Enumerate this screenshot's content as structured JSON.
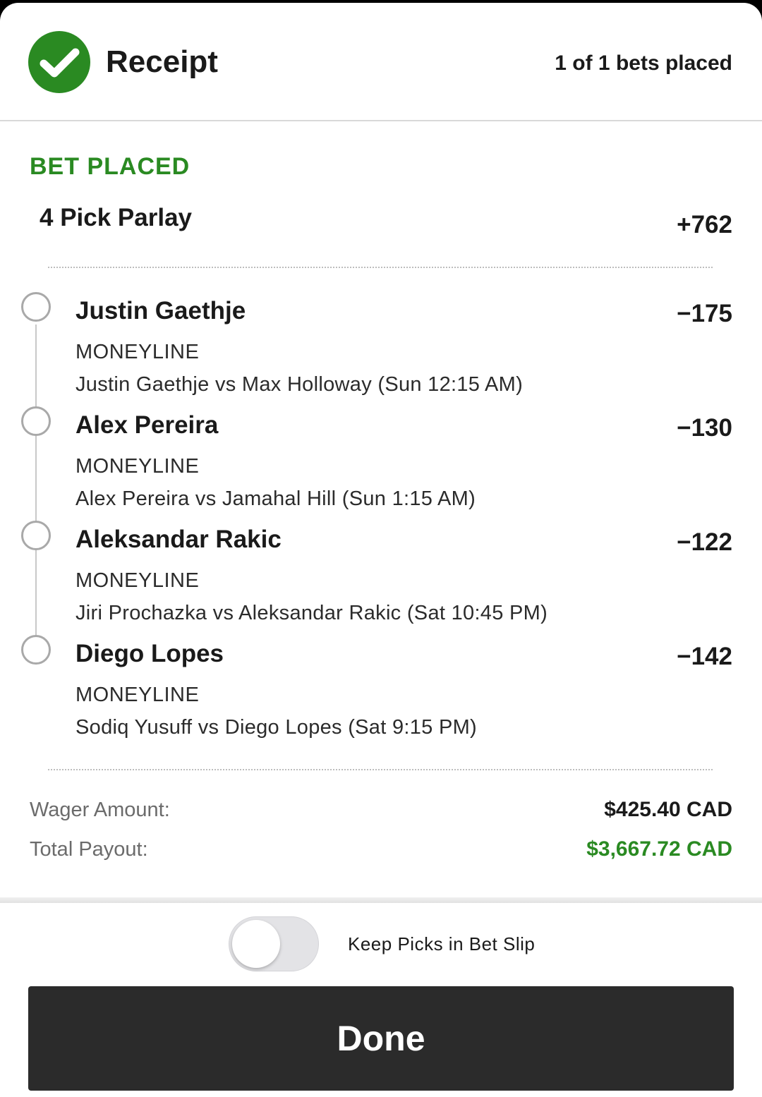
{
  "header": {
    "title": "Receipt",
    "count_text": "1 of 1 bets placed",
    "check_icon": "check-circle-icon",
    "accent_color": "#2a8a22"
  },
  "bet": {
    "status": "BET PLACED",
    "type": "4 Pick Parlay",
    "odds": "+762"
  },
  "legs": [
    {
      "name": "Justin Gaethje",
      "odds": "−175",
      "market": "MONEYLINE",
      "matchup": "Justin Gaethje vs Max Holloway (Sun 12:15 AM)"
    },
    {
      "name": "Alex Pereira",
      "odds": "−130",
      "market": "MONEYLINE",
      "matchup": "Alex Pereira vs Jamahal Hill (Sun 1:15 AM)"
    },
    {
      "name": "Aleksandar Rakic",
      "odds": "−122",
      "market": "MONEYLINE",
      "matchup": "Jiri Prochazka vs Aleksandar Rakic (Sat 10:45 PM)"
    },
    {
      "name": "Diego Lopes",
      "odds": "−142",
      "market": "MONEYLINE",
      "matchup": "Sodiq Yusuff vs Diego Lopes (Sat 9:15 PM)"
    }
  ],
  "summary": {
    "wager_label": "Wager Amount:",
    "wager_value": "$425.40 CAD",
    "payout_label": "Total Payout:",
    "payout_value": "$3,667.72 CAD"
  },
  "footer": {
    "toggle_label": "Keep Picks in Bet Slip",
    "toggle_on": false,
    "done_label": "Done"
  }
}
